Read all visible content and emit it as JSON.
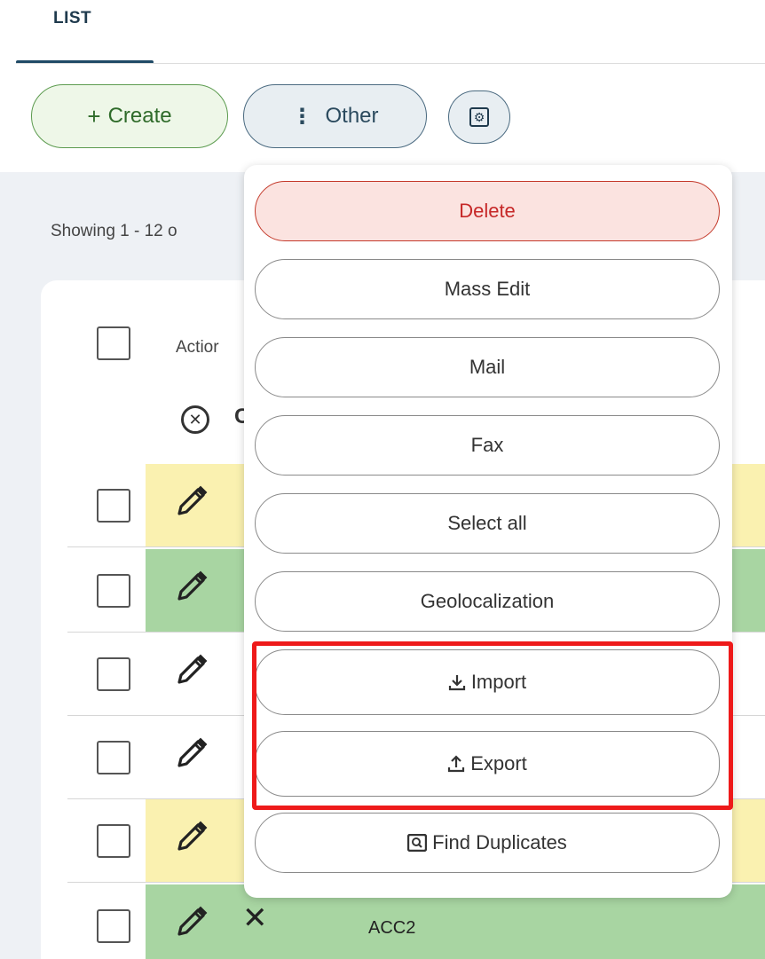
{
  "tabs": {
    "list_label": "LIST"
  },
  "toolbar": {
    "create_label": "Create",
    "other_label": "Other",
    "settings_icon": "settings-icon"
  },
  "list": {
    "showing_text": "Showing 1 - 12 o",
    "header_action_label": "Actior",
    "clear_partial_text": "C",
    "rows": [
      {
        "band": "yellow",
        "name": ""
      },
      {
        "band": "green",
        "name": ""
      },
      {
        "band": "white",
        "name": ""
      },
      {
        "band": "white",
        "name": ""
      },
      {
        "band": "yellow",
        "name": ""
      },
      {
        "band": "green",
        "name": "ACC2"
      }
    ]
  },
  "dropdown": {
    "items": [
      {
        "label": "Delete",
        "variant": "danger"
      },
      {
        "label": "Mass Edit"
      },
      {
        "label": "Mail"
      },
      {
        "label": "Fax"
      },
      {
        "label": "Select all"
      },
      {
        "label": "Geolocalization"
      },
      {
        "label": "Import",
        "icon": "download-icon"
      },
      {
        "label": "Export",
        "icon": "upload-icon"
      },
      {
        "label": "Find Duplicates",
        "icon": "search-icon"
      }
    ]
  },
  "colors": {
    "create_bg": "#eef7e8",
    "other_bg": "#e8eef2",
    "delete_bg": "#fbe3e0",
    "highlight": "#ee1a1a",
    "row_yellow": "#faf1b0",
    "row_green": "#a8d5a2"
  }
}
